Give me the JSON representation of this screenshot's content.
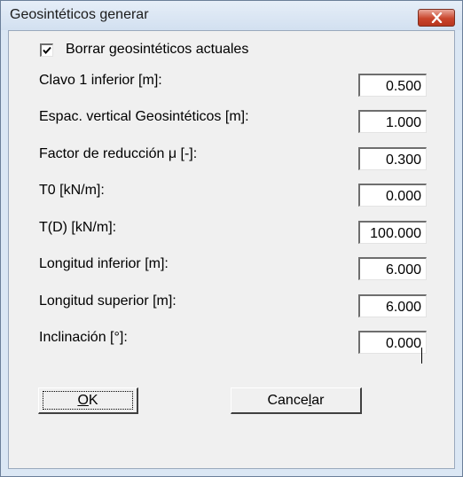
{
  "window": {
    "title": "Geosintéticos generar",
    "close_icon": "close-icon",
    "close_color": "#c9452c"
  },
  "checkbox": {
    "label": "Borrar geosintéticos actuales",
    "checked": true
  },
  "fields": [
    {
      "label": "Clavo 1 inferior [m]:",
      "value": "0.500"
    },
    {
      "label": "Espac. vertical Geosintéticos [m]:",
      "value": "1.000"
    },
    {
      "label": "Factor de reducción μ [-]:",
      "value": "0.300"
    },
    {
      "label": "T0 [kN/m]:",
      "value": "0.000"
    },
    {
      "label": "T(D) [kN/m]:",
      "value": "100.000"
    },
    {
      "label": "Longitud inferior [m]:",
      "value": "6.000"
    },
    {
      "label": "Longitud superior [m]:",
      "value": "6.000"
    },
    {
      "label": "Inclinación [°]:",
      "value": "0.000"
    }
  ],
  "buttons": {
    "ok": {
      "mnemonic": "O",
      "rest": "K"
    },
    "cancel": {
      "before": "Cance",
      "mnemonic": "l",
      "after": "ar"
    }
  }
}
